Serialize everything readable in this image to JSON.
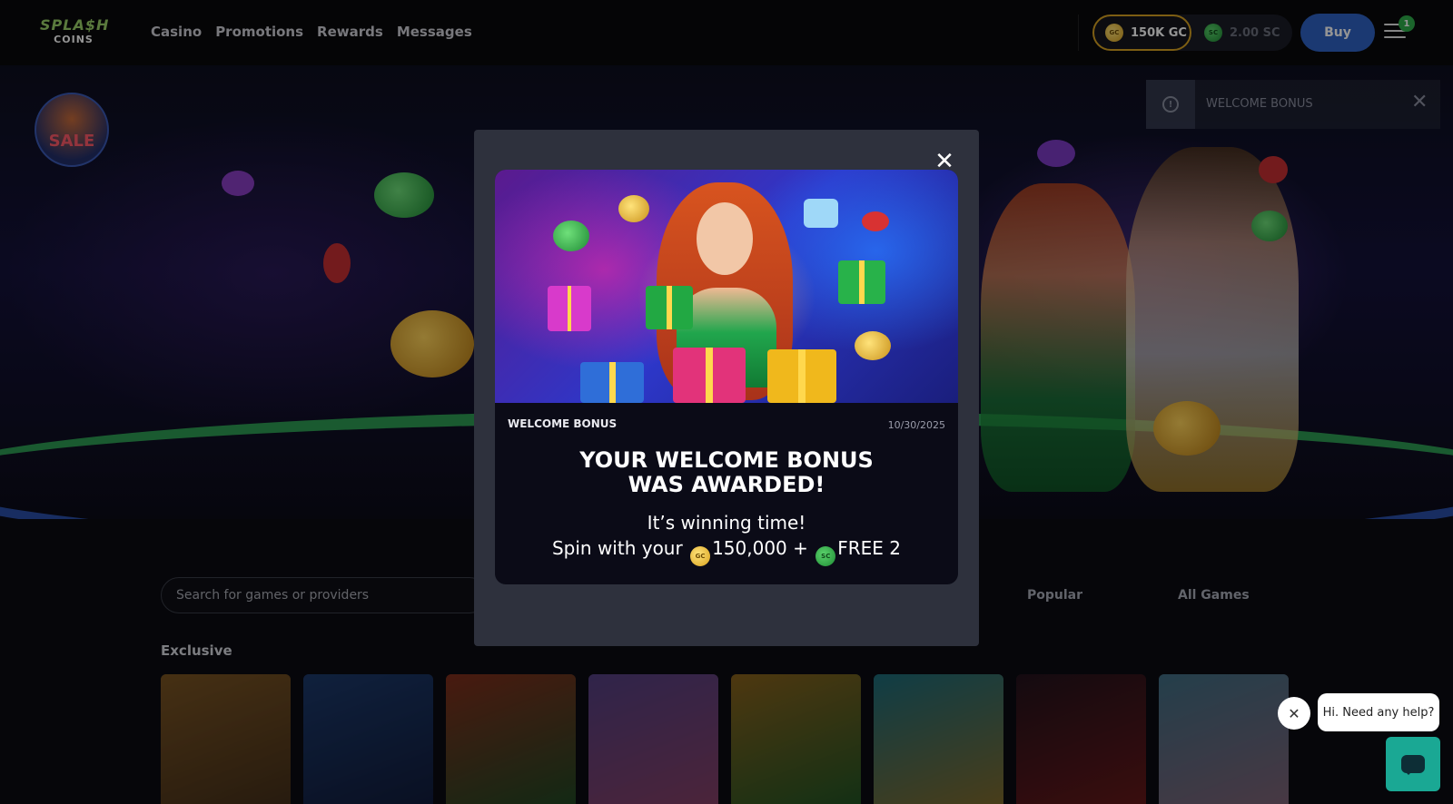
{
  "header": {
    "logo_line1": "SPLA$H",
    "logo_line2": "COINS",
    "nav": [
      "Casino",
      "Promotions",
      "Rewards",
      "Messages"
    ],
    "gc_balance": "150K GC",
    "sc_balance": "2.00 SC",
    "gc_coin": "GC",
    "sc_coin": "SC",
    "buy_label": "Buy",
    "menu_badge": "1"
  },
  "hero": {
    "sale_label": "SALE"
  },
  "toast": {
    "title": "WELCOME BONUS",
    "close": "✕"
  },
  "modal": {
    "close": "✕",
    "badge": "WELCOME BONUS",
    "date": "10/30/2025",
    "headline_line1": "YOUR WELCOME BONUS",
    "headline_line2": "WAS AWARDED!",
    "sub_line1": "It’s winning time!",
    "sub_prefix": "Spin with your",
    "gc_amount": "150,000 +",
    "sc_amount": "FREE 2",
    "gc_coin": "GC",
    "sc_coin": "SC"
  },
  "lobby": {
    "search_placeholder": "Search for games or providers",
    "tabs": [
      "Popular",
      "All Games"
    ],
    "section_title": "Exclusive",
    "game_colors": [
      [
        "#c98b3a",
        "#6b4a2a"
      ],
      [
        "#2f5fb0",
        "#1b2b5e"
      ],
      [
        "#d14c2f",
        "#2a7a3d"
      ],
      [
        "#8a6ad6",
        "#e06aa4"
      ],
      [
        "#e0a030",
        "#2b8a3e"
      ],
      [
        "#2fb0c8",
        "#e0b040"
      ],
      [
        "#3b1f2f",
        "#b02a2a"
      ],
      [
        "#6ab4d8",
        "#d8a0c0"
      ]
    ]
  },
  "chat": {
    "dismiss": "✕",
    "greeting": "Hi. Need any help?"
  },
  "colors": {
    "accent_blue": "#2f63c4",
    "gold": "#d8a321",
    "green": "#2fae4a",
    "chat_teal": "#1aa894"
  }
}
